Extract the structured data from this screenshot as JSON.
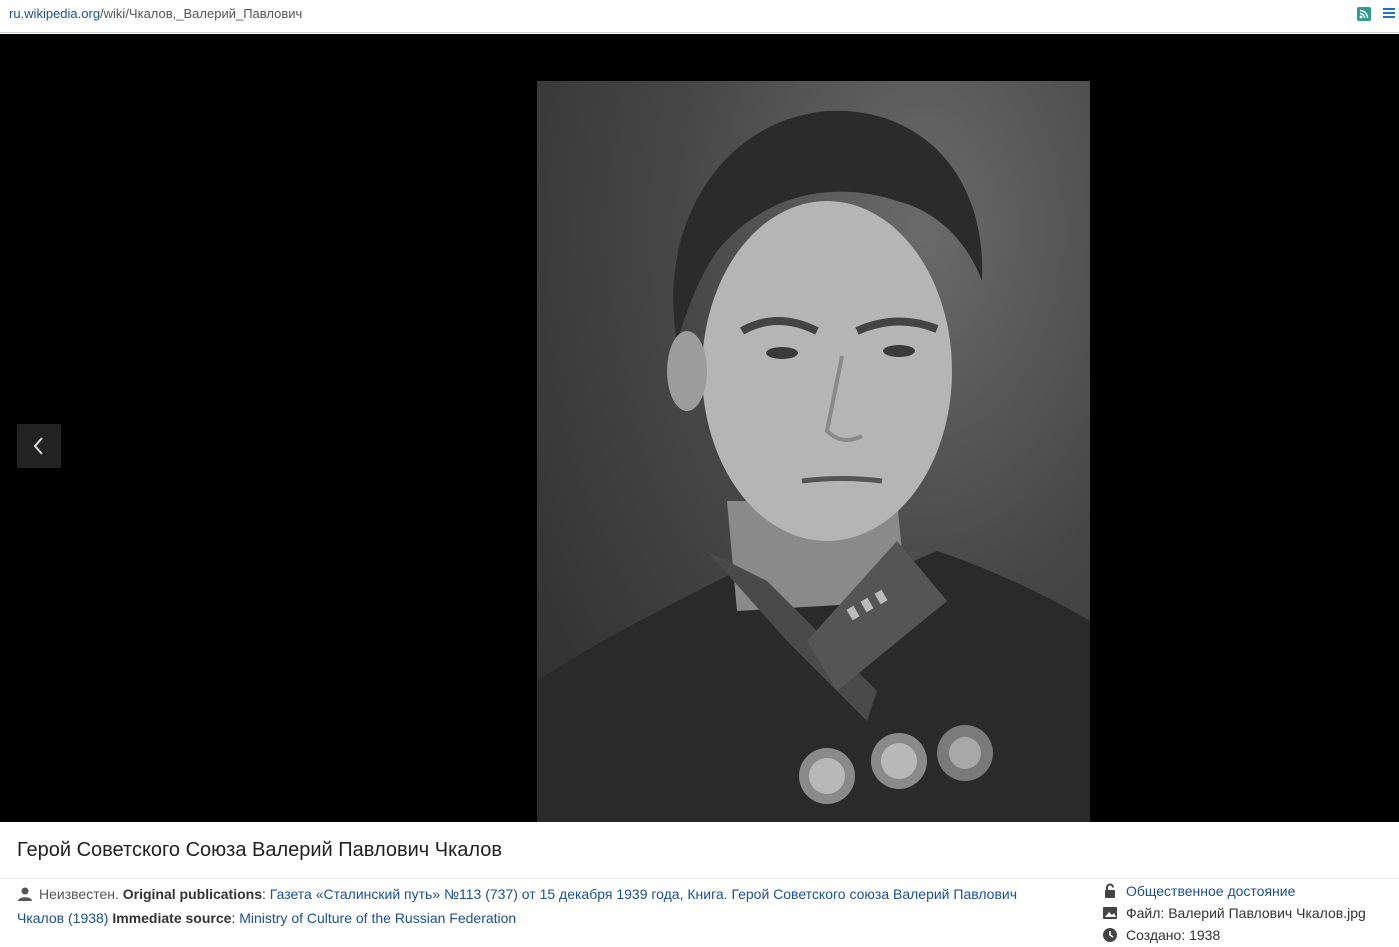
{
  "address": {
    "domain": "ru.wikipedia.org",
    "path": "/wiki/Чкалов,_Валерий_Павлович"
  },
  "viewer": {
    "prev_icon": "chevron-left-icon",
    "photo_alt": "Герой Советского Союза Валерий Павлович Чкалов"
  },
  "caption": {
    "title": "Герой Советского Союза Валерий Павлович Чкалов",
    "author": "Неизвестен.",
    "original_publications_label": "Original publications",
    "publications_sep": ":",
    "publication_link": "Газета «Сталинский путь» №113 (737) от 15 декабря 1939 года, Книга. Герой Советского союза Валерий Павлович Чкалов (1938)",
    "immediate_source_label": "Immediate source",
    "source_sep": ":",
    "source_link": "Ministry of Culture of the Russian Federation"
  },
  "meta": {
    "license": "Общественное достояние",
    "file": "Файл: Валерий Павлович Чкалов.jpg",
    "created": "Создано: 1938"
  },
  "colors": {
    "link": "#1a4f9a",
    "viewer_bg": "#000000"
  }
}
